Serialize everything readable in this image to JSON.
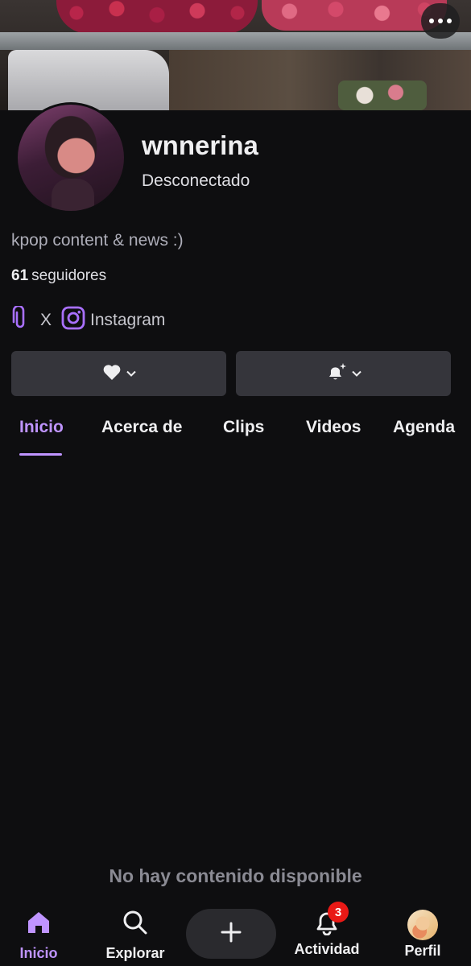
{
  "banner": {
    "more_icon": "ellipsis-icon"
  },
  "profile": {
    "username": "wnnerina",
    "status": "Desconectado",
    "bio": "kpop content & news :)",
    "followers_count": "61",
    "followers_label": "seguidores"
  },
  "links": [
    {
      "icon": "paperclip-icon",
      "label": "X"
    },
    {
      "icon": "instagram-icon",
      "label": "Instagram"
    }
  ],
  "actions": {
    "follow_icon": "heart-icon",
    "notify_icon": "bell-sparkle-icon"
  },
  "tabs": [
    "Inicio",
    "Acerca de",
    "Clips",
    "Videos",
    "Agenda"
  ],
  "active_tab": "Inicio",
  "empty_message": "No hay contenido disponible",
  "bottom_nav": {
    "home": "Inicio",
    "explore": "Explorar",
    "activity": "Actividad",
    "activity_badge": "3",
    "profile": "Perfil"
  },
  "colors": {
    "background": "#0e0e10",
    "accent": "#bf94ff",
    "button": "#35353b",
    "badge": "#e91916"
  }
}
